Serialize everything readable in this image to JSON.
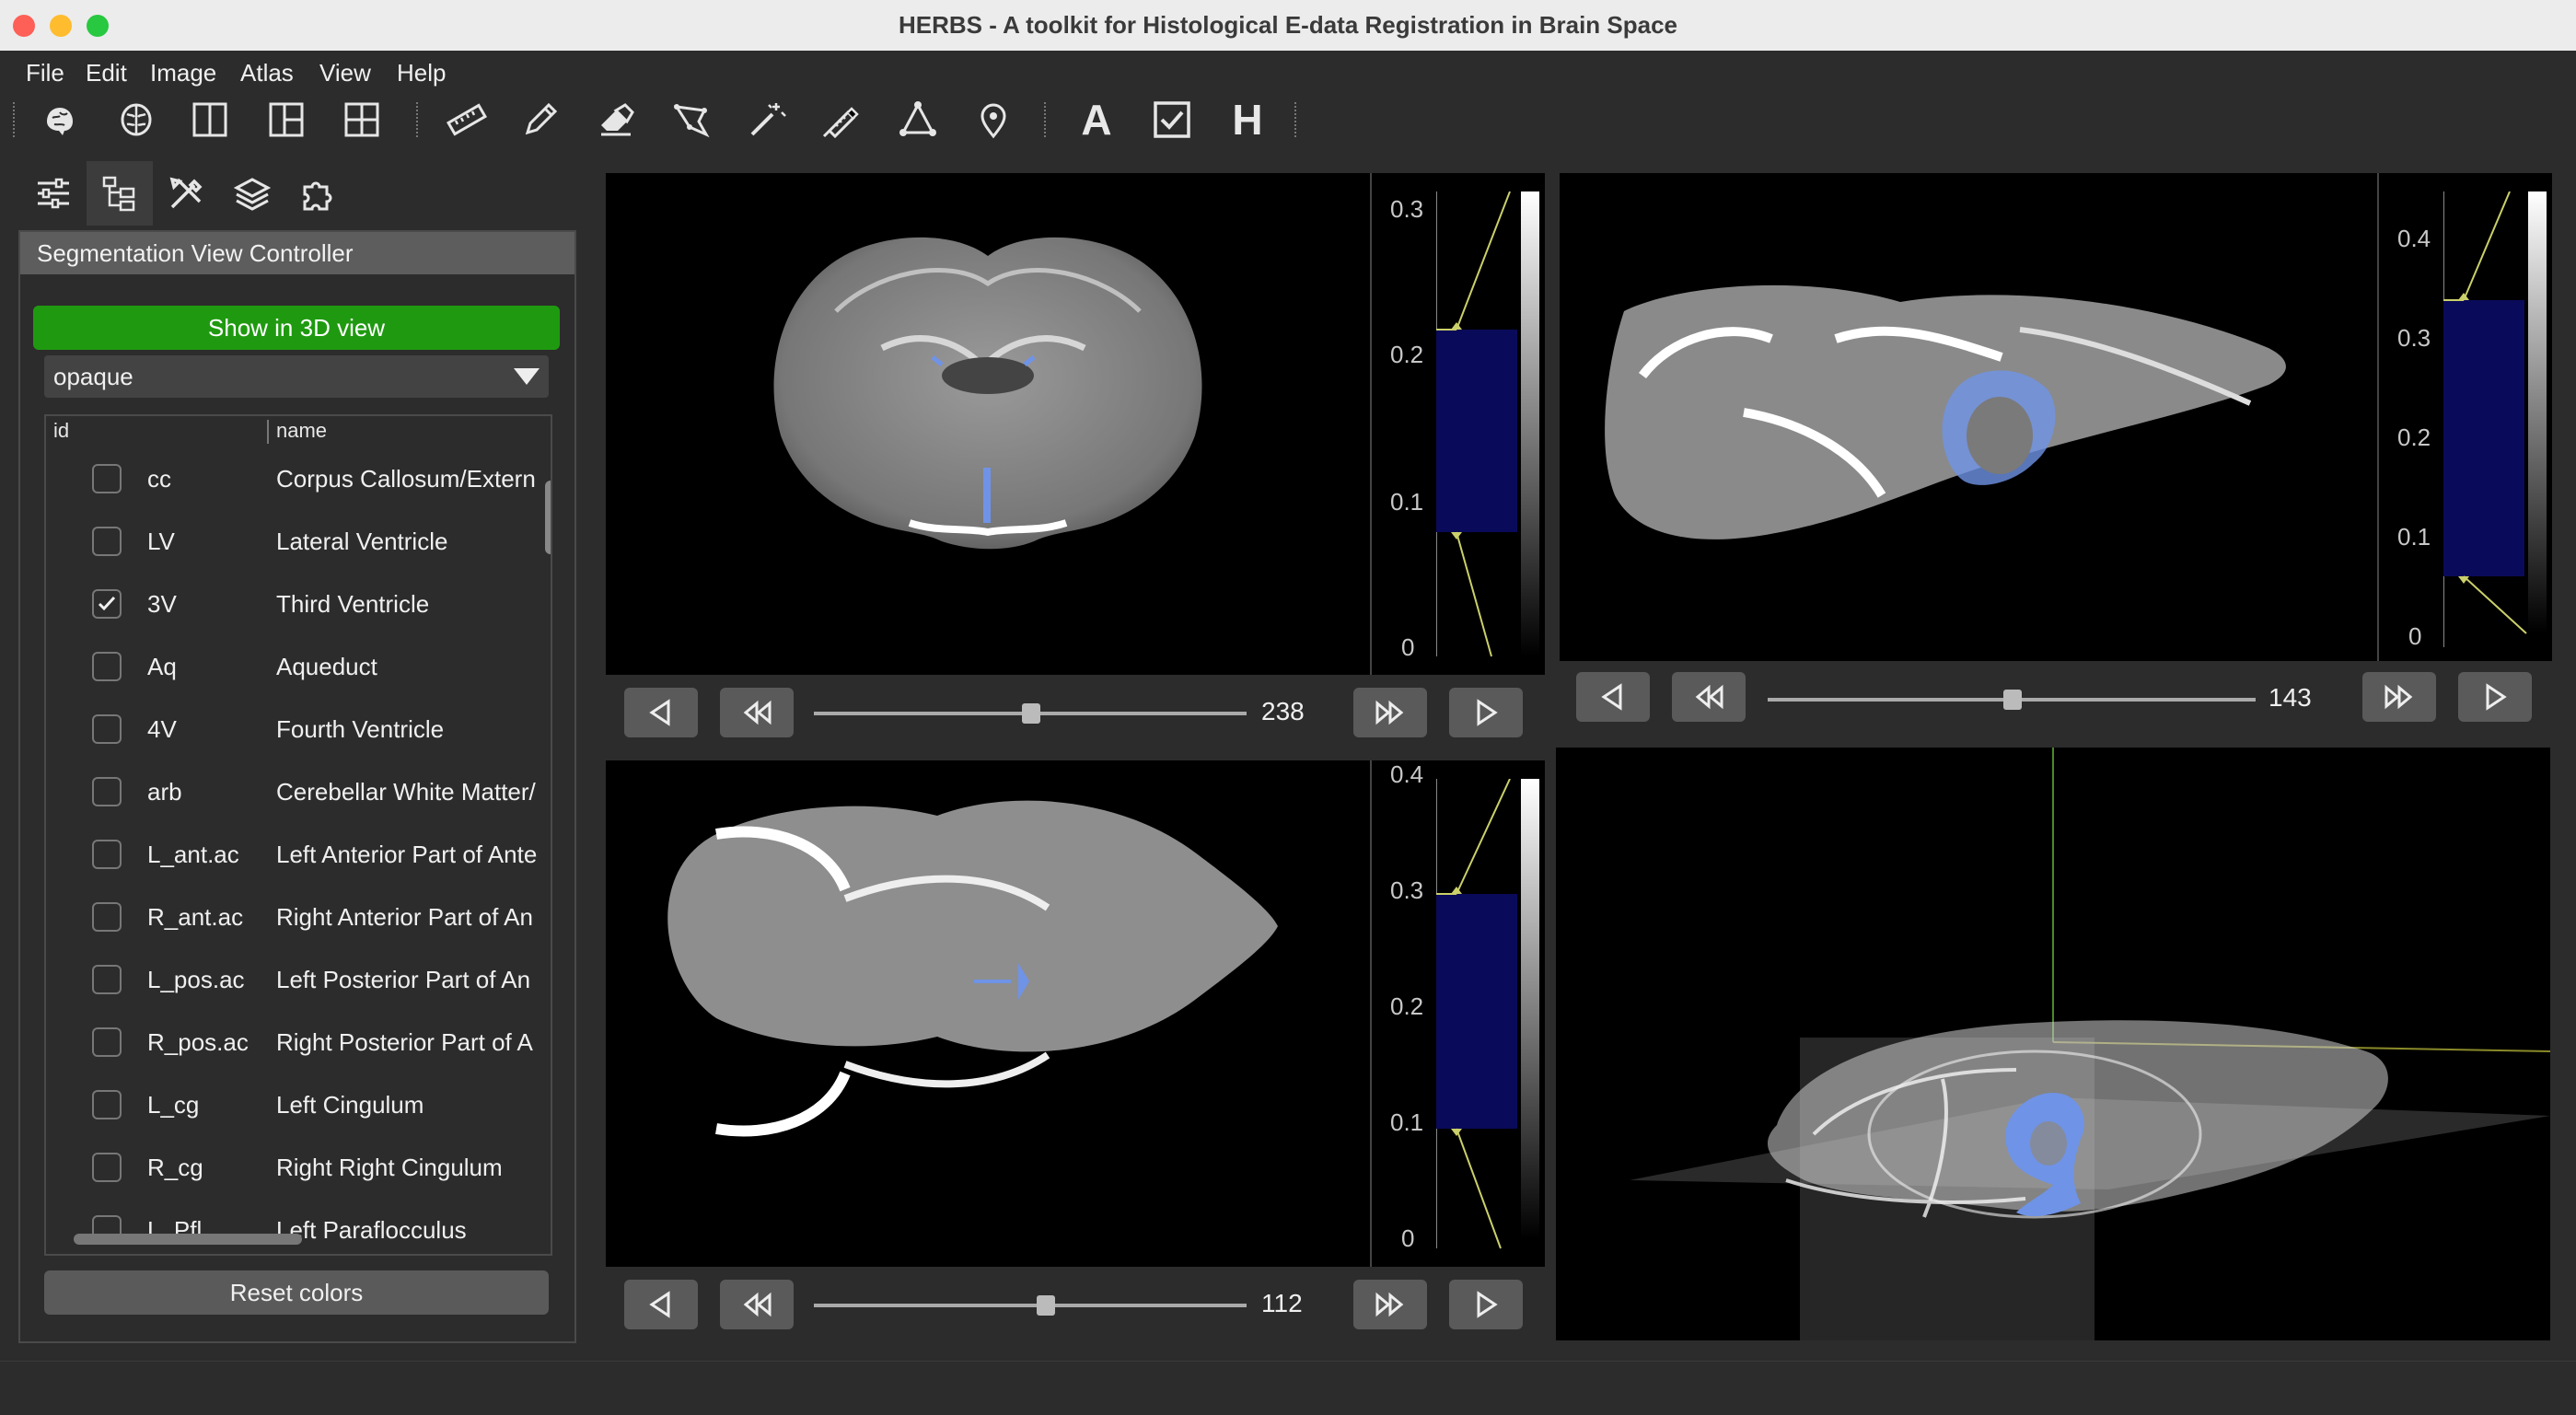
{
  "window": {
    "title": "HERBS - A toolkit for Histological E-data Registration in Brain Space"
  },
  "menu": [
    "File",
    "Edit",
    "Image",
    "Atlas",
    "View",
    "Help"
  ],
  "toolbar": {
    "icons": [
      "brain-icon",
      "brain-outline-icon",
      "layout-two-column-icon",
      "layout-three-pane-icon",
      "layout-grid-icon",
      "ruler-icon",
      "pencil-icon",
      "eraser-icon",
      "lasso-icon",
      "magic-wand-icon",
      "probe-icon",
      "triangle-icon",
      "location-pin-icon",
      "text-icon",
      "checkbox-icon",
      "h-icon"
    ],
    "text_tool": "A",
    "h_tool": "H"
  },
  "left_tabs": [
    "sliders-icon",
    "tree-icon",
    "tools-icon",
    "layers-icon",
    "puzzle-icon"
  ],
  "panel": {
    "title": "Segmentation View Controller",
    "show_button": "Show in 3D view",
    "select_value": "opaque",
    "col_id": "id",
    "col_name": "name",
    "reset_button": "Reset colors",
    "rows": [
      {
        "id": "cc",
        "name": "Corpus Callosum/Extern",
        "checked": false
      },
      {
        "id": "LV",
        "name": "Lateral Ventricle",
        "checked": false
      },
      {
        "id": "3V",
        "name": "Third Ventricle",
        "checked": true
      },
      {
        "id": "Aq",
        "name": "Aqueduct",
        "checked": false
      },
      {
        "id": "4V",
        "name": "Fourth Ventricle",
        "checked": false
      },
      {
        "id": "arb",
        "name": "Cerebellar White Matter/",
        "checked": false
      },
      {
        "id": "L_ant.ac",
        "name": "Left Anterior Part of Ante",
        "checked": false
      },
      {
        "id": "R_ant.ac",
        "name": "Right Anterior Part of An",
        "checked": false
      },
      {
        "id": "L_pos.ac",
        "name": "Left Posterior Part of An",
        "checked": false
      },
      {
        "id": "R_pos.ac",
        "name": "Right Posterior Part of A",
        "checked": false
      },
      {
        "id": "L_cg",
        "name": "Left Cingulum",
        "checked": false
      },
      {
        "id": "R_cg",
        "name": "Right Right Cingulum",
        "checked": false
      },
      {
        "id": "L_Pfl",
        "name": "Left Paraflocculus",
        "checked": false
      }
    ]
  },
  "viewers": {
    "coronal": {
      "slice": "238",
      "ticks": [
        "0.3",
        "0.2",
        "0.1",
        "0"
      ]
    },
    "sagittal": {
      "slice": "143",
      "ticks": [
        "0.4",
        "0.3",
        "0.2",
        "0.1",
        "0"
      ]
    },
    "horizontal": {
      "slice": "112",
      "ticks": [
        "0.4",
        "0.3",
        "0.2",
        "0.1",
        "0"
      ]
    }
  },
  "colors": {
    "accent_green": "#1f9a10",
    "segmentation_blue": "#6f93e6",
    "histogram_fill": "#0a0a5a"
  }
}
